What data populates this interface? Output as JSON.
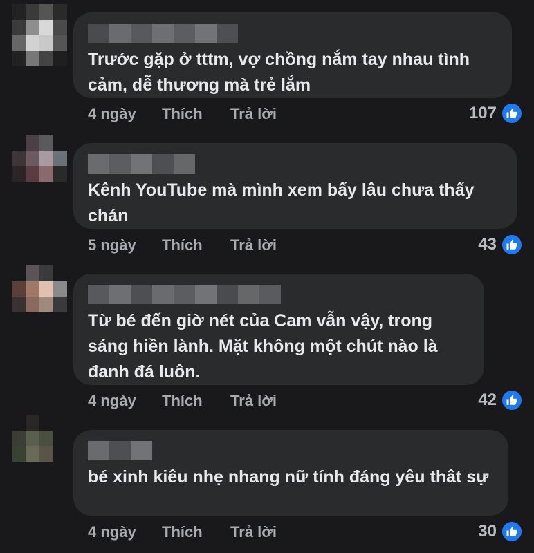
{
  "comments": [
    {
      "text": "Trước gặp ở tttm, vợ chồng nắm tay nhau tình cảm, dễ thương mà trẻ lắm",
      "time": "4 ngày",
      "like": "Thích",
      "reply": "Trả lời",
      "reactions": "107"
    },
    {
      "text": "Kênh YouTube mà mình xem bấy lâu chưa thấy chán",
      "time": "5 ngày",
      "like": "Thích",
      "reply": "Trả lời",
      "reactions": "43"
    },
    {
      "text": "Từ bé đến giờ nét của Cam vẫn vậy, trong sáng hiền lành. Mặt không một chút nào là đanh đá luôn.",
      "time": "4 ngày",
      "like": "Thích",
      "reply": "Trả lời",
      "reactions": "42"
    },
    {
      "text": "bé xinh kiêu nhẹ nhang nữ tính đáng yêu thât sự",
      "time": "4 ngày",
      "like": "Thích",
      "reply": "Trả lời",
      "reactions": "30"
    }
  ],
  "colors": {
    "background": "#19191b",
    "bubble": "#2a2b2d",
    "text": "#e8e9ec",
    "meta": "#a9abb1",
    "like_badge": "#1d7af2"
  },
  "icons": {
    "reaction": "thumbs-up-icon"
  }
}
